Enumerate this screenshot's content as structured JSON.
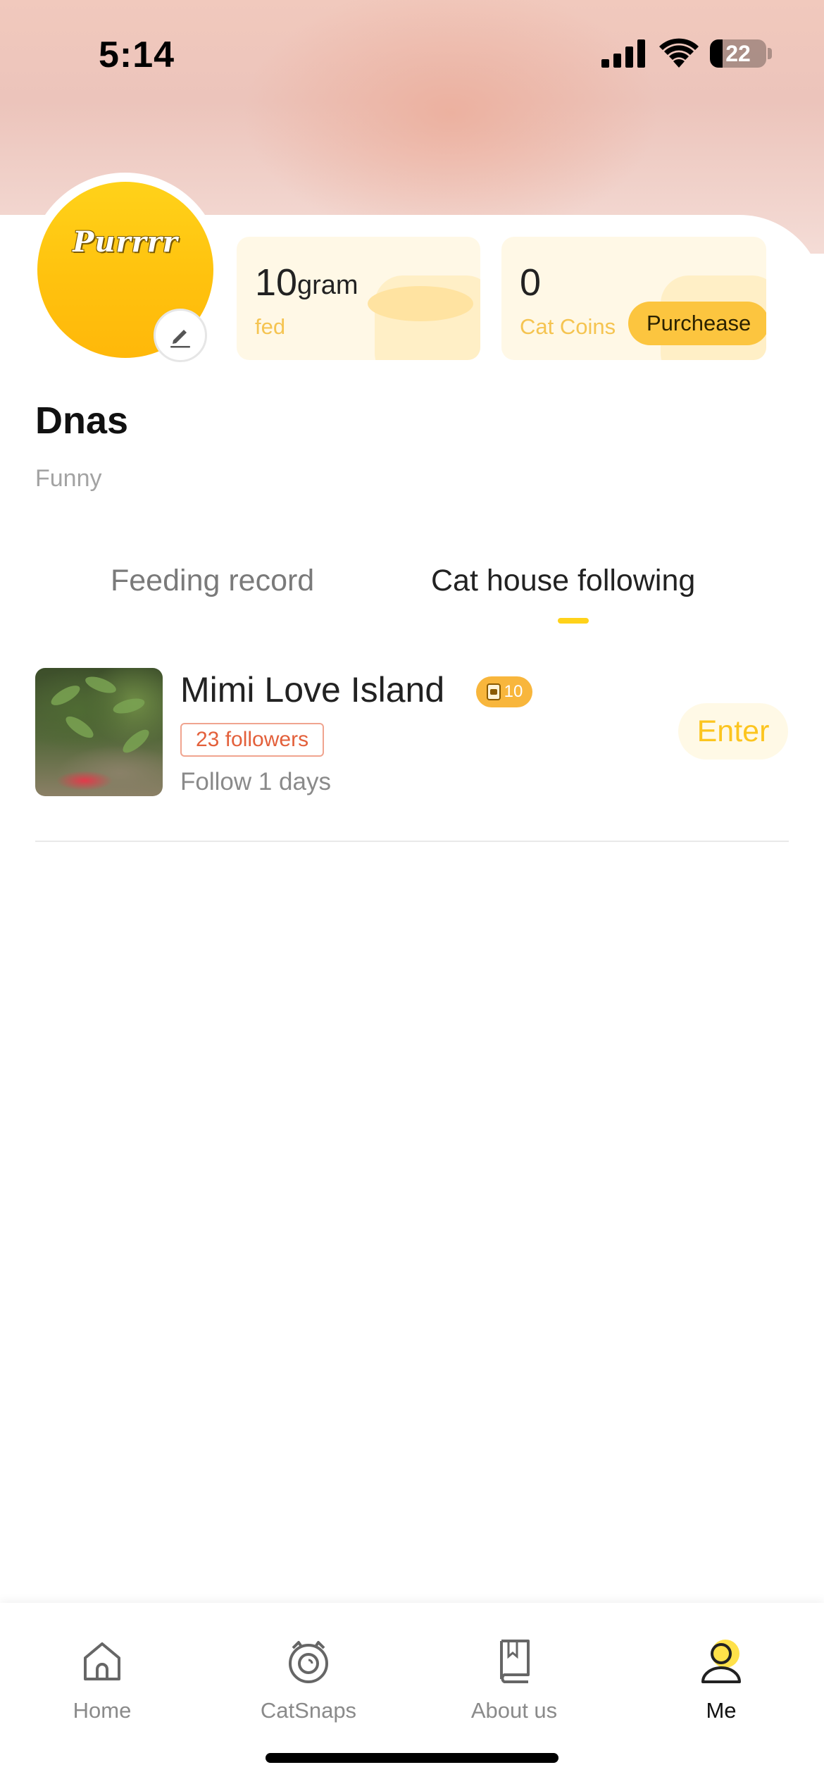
{
  "status_bar": {
    "time": "5:14",
    "battery_level": "22",
    "battery_fraction": 0.22
  },
  "profile": {
    "avatar_text": "Purrrr",
    "name": "Dnas",
    "bio": "Funny",
    "edit_icon": "pencil-icon"
  },
  "stats": {
    "fed": {
      "value": "10",
      "unit": "gram",
      "label": "fed"
    },
    "coins": {
      "value": "0",
      "label": "Cat Coins",
      "purchase_label": "Purchease"
    }
  },
  "tabs": [
    {
      "label": "Feeding record",
      "active": false
    },
    {
      "label": "Cat house following",
      "active": true
    }
  ],
  "following": [
    {
      "title": "Mimi Love Island",
      "coin_badge": "10",
      "followers": "23 followers",
      "follow_days": "Follow 1 days",
      "enter_label": "Enter"
    }
  ],
  "bottom_nav": [
    {
      "label": "Home",
      "icon": "house-icon",
      "active": false
    },
    {
      "label": "CatSnaps",
      "icon": "cat-camera-icon",
      "active": false
    },
    {
      "label": "About us",
      "icon": "book-icon",
      "active": false
    },
    {
      "label": "Me",
      "icon": "person-icon",
      "active": true
    }
  ],
  "colors": {
    "accent_yellow": "#ffd21a",
    "coin_label": "#f5c451",
    "followers_tag": "#e3603b",
    "enter_text": "#fcc51f"
  }
}
